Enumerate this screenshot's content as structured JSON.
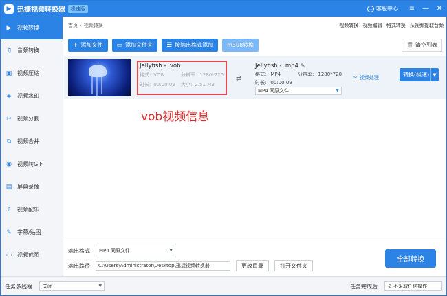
{
  "app": {
    "title": "迅捷视频转换器",
    "badge": "极速版"
  },
  "titlebar": {
    "support_label": "客服中心"
  },
  "sidebar": {
    "items": [
      {
        "label": "视频转换",
        "icon": "video-convert-icon"
      },
      {
        "label": "音频转换",
        "icon": "audio-icon"
      },
      {
        "label": "视频压缩",
        "icon": "compress-icon"
      },
      {
        "label": "视频水印",
        "icon": "watermark-icon"
      },
      {
        "label": "视频分割",
        "icon": "split-icon"
      },
      {
        "label": "视频合并",
        "icon": "merge-icon"
      },
      {
        "label": "视频转GIF",
        "icon": "gif-icon"
      },
      {
        "label": "屏幕录像",
        "icon": "record-icon"
      },
      {
        "label": "视频配乐",
        "icon": "music-icon"
      },
      {
        "label": "字幕/贴图",
        "icon": "subtitle-icon"
      },
      {
        "label": "视频截图",
        "icon": "screenshot-icon"
      }
    ]
  },
  "breadcrumb": {
    "home": "首页",
    "current": "视频转换"
  },
  "top_links": [
    "视频转换",
    "视频编辑",
    "格式转换",
    "从视频提取音频"
  ],
  "toolbar": {
    "add_file": "添加文件",
    "add_folder": "添加文件夹",
    "add_by_format": "按输出格式添加",
    "m3u8": "m3u8转换",
    "clear_list": "清空列表"
  },
  "source": {
    "name": "Jellyfish - .vob",
    "format_label": "格式:",
    "format_value": "VOB",
    "resolution_label": "分辨率:",
    "resolution_value": "1280*720",
    "duration_label": "时长:",
    "duration_value": "00:00:09",
    "size_label": "大小:",
    "size_value": "2.51 MB"
  },
  "target": {
    "name": "Jellyfish - .mp4",
    "format_label": "格式:",
    "format_value": "MP4",
    "resolution_label": "分辨率:",
    "resolution_value": "1280*720",
    "duration_label": "时长:",
    "duration_value": "00:00:09",
    "select_value": "MP4  同原文件"
  },
  "row_actions": {
    "video_process": "视频处理",
    "convert": "转换(极速)"
  },
  "annotation": "vob视频信息",
  "output": {
    "format_label": "输出格式:",
    "format_value": "MP4  同原文件",
    "path_label": "输出路径:",
    "path_value": "C:\\Users\\Administrator\\Desktop\\迅捷视频转换器",
    "change_dir": "更改目录",
    "open_folder": "打开文件夹",
    "convert_all": "全部转换"
  },
  "statusbar": {
    "multithread_label": "任务多线程",
    "multithread_value": "关闭",
    "after_done_label": "任务完成后",
    "after_done_value": "不采取任何操作"
  }
}
